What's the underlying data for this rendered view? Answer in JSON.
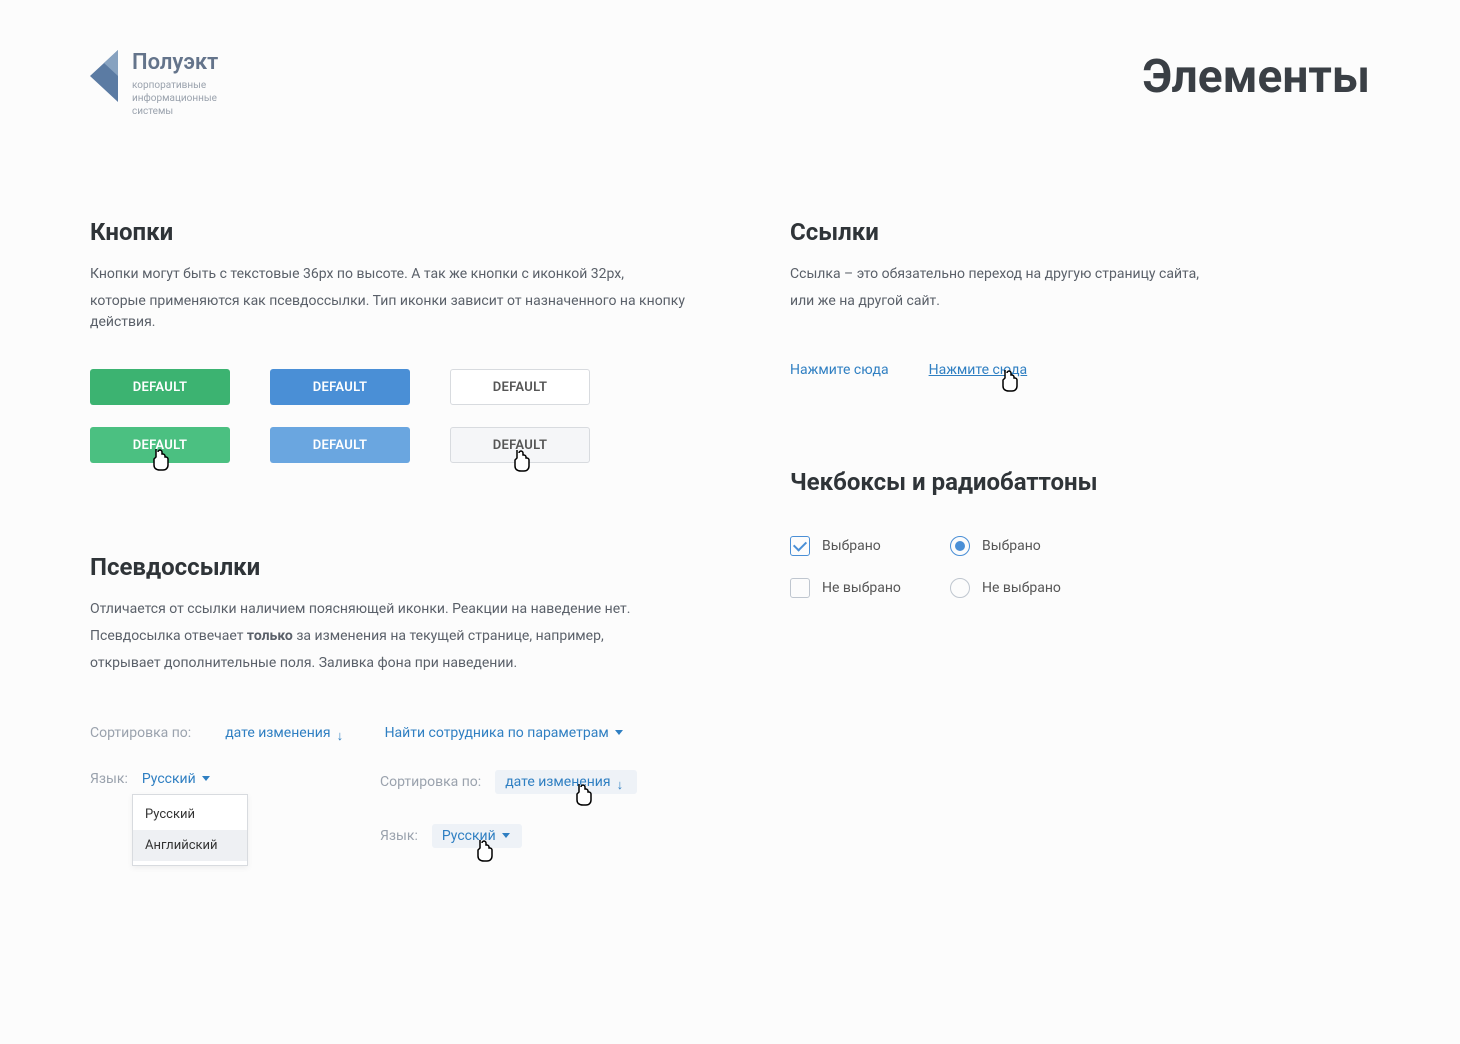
{
  "header": {
    "logo_title": "Полуэкт",
    "logo_sub1": "корпоративные",
    "logo_sub2": "информационные",
    "logo_sub3": "системы",
    "page_title": "Элементы"
  },
  "buttons": {
    "heading": "Кнопки",
    "desc1": "Кнопки могут быть с текстовые 36px по высоте. А так же кнопки с иконкой 32px,",
    "desc2": "которые применяются как псевдоссылки. Тип иконки зависит от назначенного на кнопку действия.",
    "label": "DEFAULT"
  },
  "links": {
    "heading": "Ссылки",
    "desc1": "Ссылка – это обязательно переход на другую страницу сайта,",
    "desc2": "или же на другой сайт.",
    "link1": "Нажмите сюда",
    "link2": "Нажмите сюда"
  },
  "pseudo": {
    "heading": "Псевдоссылки",
    "desc1": "Отличается от ссылки наличием поясняющей иконки. Реакции на наведение нет.",
    "desc2_a": "Псевдосылка отвечает ",
    "desc2_b": "только",
    "desc2_c": " за изменения на текущей странице, например,",
    "desc3": "открывает дополнительные поля. Заливка фона при наведении.",
    "sort_label": "Сортировка по:",
    "sort_value": "дате изменения",
    "find_value": "Найти сотрудника по параметрам",
    "lang_label": "Язык:",
    "lang_value": "Русский",
    "dropdown_opt1": "Русский",
    "dropdown_opt2": "Английский"
  },
  "checks": {
    "heading": "Чекбоксы и радиобаттоны",
    "selected": "Выбрано",
    "not_selected": "Не выбрано"
  }
}
